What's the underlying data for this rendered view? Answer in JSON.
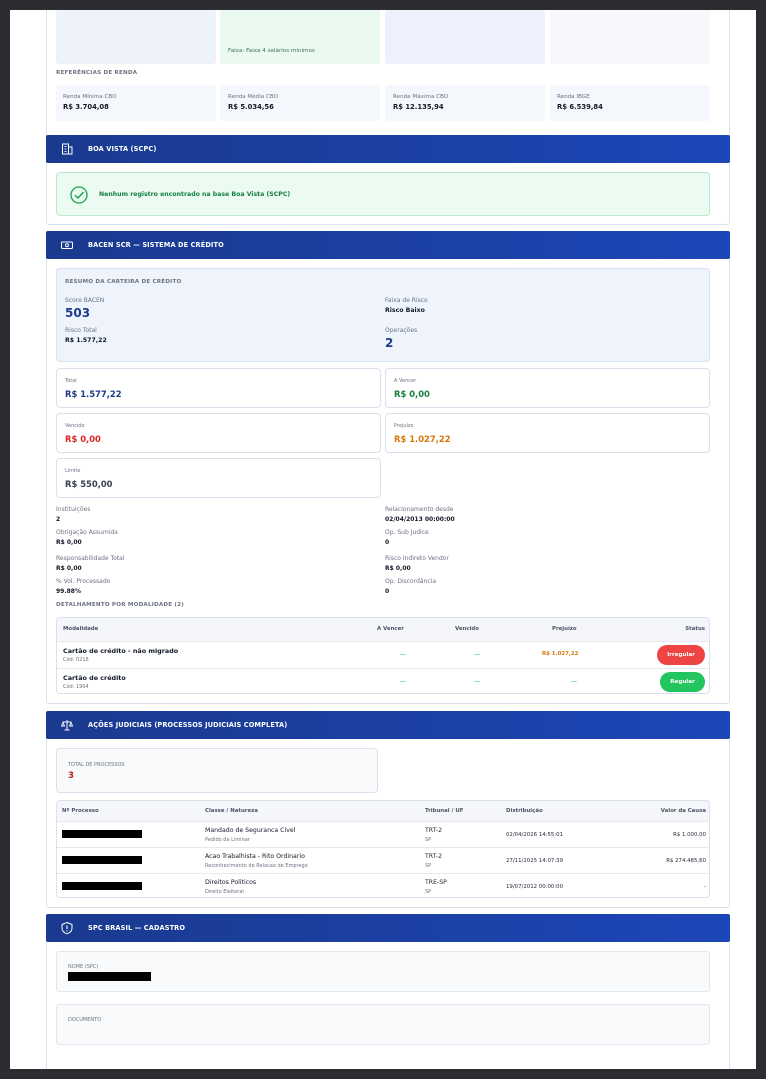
{
  "top": {
    "faixa": "Faixa: Faixa 4 salários mínimos",
    "ref_title": "REFERÊNCIAS DE RENDA",
    "refs": [
      {
        "label": "Renda Mínima CBO",
        "value": "R$ 3.704,08"
      },
      {
        "label": "Renda Média CBO",
        "value": "R$ 5.034,56"
      },
      {
        "label": "Renda Máxima CBO",
        "value": "R$ 12.135,94"
      },
      {
        "label": "Renda IBGE",
        "value": "R$ 6.539,84"
      }
    ]
  },
  "boavista": {
    "title": "BOA VISTA (SCPC)",
    "message": "Nenhum registro encontrado na base Boa Vista (SCPC)"
  },
  "bacen": {
    "title": "BACEN SCR — SISTEMA DE CRÉDITO",
    "resumo_title": "RESUMO DA CARTEIRA DE CRÉDITO",
    "score_label": "Score BACEN",
    "score": "503",
    "faixa_label": "Faixa de Risco",
    "faixa": "Risco Baixo",
    "risco_label": "Risco Total",
    "risco": "R$ 1.577,22",
    "oper_label": "Operações",
    "oper": "2",
    "cards": {
      "total_label": "Total",
      "total": "R$ 1.577,22",
      "avencer_label": "A Vencer",
      "avencer": "R$ 0,00",
      "vencido_label": "Vencido",
      "vencido": "R$ 0,00",
      "prejuizo_label": "Prejuízo",
      "prejuizo": "R$ 1.027,22",
      "limite_label": "Limite",
      "limite": "R$ 550,00"
    },
    "details": {
      "inst_label": "Instituições",
      "inst": "2",
      "rel_label": "Relacionamento desde",
      "rel": "02/04/2013 00:00:00",
      "obr_label": "Obrigação Assumida",
      "obr": "R$ 0,00",
      "sub_label": "Op. Sub Judice",
      "sub": "0",
      "resp_label": "Responsabilidade Total",
      "resp": "R$ 0,00",
      "ind_label": "Risco Indireto Vendor",
      "ind": "R$ 0,00",
      "vol_label": "% Vol. Processado",
      "vol": "99.88%",
      "disc_label": "Op. Discordância",
      "disc": "0"
    },
    "mod_title": "DETALHAMENTO POR MODALIDADE (2)",
    "mod_headers": {
      "modalidade": "Modalidade",
      "avencer": "A Vencer",
      "vencido": "Vencido",
      "prejuizo": "Prejuízo",
      "status": "Status"
    },
    "mod_rows": [
      {
        "name": "Cartão de crédito - não migrado",
        "code": "Cód: 0218",
        "avencer": "—",
        "vencido": "—",
        "prejuizo": "R$ 1.027,22",
        "status": "Irregular"
      },
      {
        "name": "Cartão de crédito",
        "code": "Cód: 1904",
        "avencer": "—",
        "vencido": "—",
        "prejuizo": "—",
        "status": "Regular"
      }
    ]
  },
  "acoes": {
    "title": "AÇÕES JUDICIAIS (PROCESSOS JUDICIAIS COMPLETA)",
    "total_label": "TOTAL DE PROCESSOS",
    "total": "3",
    "headers": {
      "num": "Nº Processo",
      "classe": "Classe / Natureza",
      "trib": "Tribunal / UF",
      "dist": "Distribuição",
      "valor": "Valor da Causa"
    },
    "rows": [
      {
        "classe": "Mandado de Seguranca Cível",
        "natureza": "Pedido de Liminar",
        "trib": "TRT-2",
        "uf": "SP",
        "dist": "02/04/2026 14:55:01",
        "valor": "R$ 1.000,00"
      },
      {
        "classe": "Acao Trabalhista - Rito Ordinario",
        "natureza": "Reconhecimento de Relacao de Emprego",
        "trib": "TRT-2",
        "uf": "SP",
        "dist": "27/11/2025 14:07:39",
        "valor": "R$ 274.485,60"
      },
      {
        "classe": "Direitos Politicos",
        "natureza": "Direito Eleitoral",
        "trib": "TRE-SP",
        "uf": "SP",
        "dist": "19/07/2012 00:00:00",
        "valor": "-"
      }
    ]
  },
  "spc": {
    "title": "SPC BRASIL — CADASTRO",
    "nome_label": "NOME (SPC)",
    "doc_label": "DOCUMENTO"
  },
  "colors": {
    "header_blue": "#1d46b8",
    "green": "#16a34a",
    "red": "#dc2626",
    "orange": "#d97706",
    "navy": "#1e3a8a"
  }
}
